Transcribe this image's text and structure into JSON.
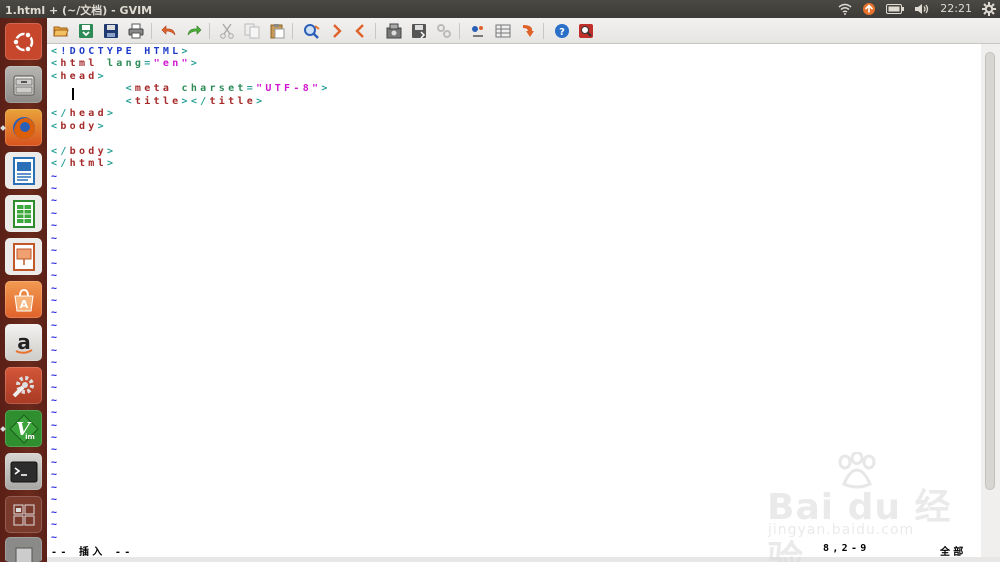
{
  "window": {
    "title": "1.html + (~/文档) - GVIM"
  },
  "panel": {
    "indicators": [
      "wifi-icon",
      "update-icon",
      "battery-icon",
      "volume-icon"
    ],
    "clock": "22:21",
    "settings_icon": "gear-icon"
  },
  "launcher": {
    "items": [
      {
        "name": "ubuntu-dash-button",
        "icon": "ubuntu-logo-icon",
        "color": "#c6472b"
      },
      {
        "name": "files-launcher",
        "icon": "file-cabinet-icon",
        "color": "#9a9a98"
      },
      {
        "name": "firefox-launcher",
        "icon": "firefox-icon",
        "color": "#e66000"
      },
      {
        "name": "writer-launcher",
        "icon": "writer-document-icon",
        "color": "#2a6fb8"
      },
      {
        "name": "calc-launcher",
        "icon": "calc-spreadsheet-icon",
        "color": "#2e8b2e"
      },
      {
        "name": "impress-launcher",
        "icon": "impress-presentation-icon",
        "color": "#c0582a"
      },
      {
        "name": "software-center-launcher",
        "icon": "software-bag-icon",
        "color": "#e8712b"
      },
      {
        "name": "amazon-launcher",
        "icon": "amazon-icon",
        "color": "#d8d6d2"
      },
      {
        "name": "system-settings-launcher",
        "icon": "wrench-gear-icon",
        "color": "#b8402a"
      },
      {
        "name": "vim-launcher",
        "icon": "vim-icon",
        "color": "#2f8f2f"
      },
      {
        "name": "terminal-launcher",
        "icon": "terminal-icon",
        "color": "#2c2c2c"
      },
      {
        "name": "workspace-switcher",
        "icon": "workspace-icon",
        "color": "#7a3a2c"
      },
      {
        "name": "trash-launcher",
        "icon": "trash-icon",
        "color": "#8a8a88"
      }
    ]
  },
  "toolbar": {
    "buttons": [
      "open-icon",
      "save-icon",
      "save-all-icon",
      "print-icon",
      "undo-icon",
      "redo-icon",
      "cut-icon",
      "copy-icon",
      "paste-icon",
      "find-replace-icon",
      "find-next-icon",
      "find-prev-icon",
      "load-session-icon",
      "save-session-icon",
      "run-script-icon",
      "make-icon",
      "shell-icon",
      "ctags-icon",
      "help-icon",
      "find-help-icon"
    ]
  },
  "editor": {
    "lines": [
      [
        [
          "<",
          "brk"
        ],
        [
          "!DOCTYPE HTML",
          "decl"
        ],
        [
          ">",
          "brk"
        ]
      ],
      [
        [
          "<",
          "brk"
        ],
        [
          "html",
          "tag"
        ],
        [
          " lang",
          "attr"
        ],
        [
          "=",
          "brk"
        ],
        [
          "\"en\"",
          "str"
        ],
        [
          ">",
          "brk"
        ]
      ],
      [
        [
          "<",
          "brk"
        ],
        [
          "head",
          "tag"
        ],
        [
          ">",
          "brk"
        ]
      ],
      [
        [
          "        <",
          "brk"
        ],
        [
          "meta",
          "tag"
        ],
        [
          " charset",
          "attr"
        ],
        [
          "=",
          "brk"
        ],
        [
          "\"UTF-8\"",
          "str"
        ],
        [
          ">",
          "brk"
        ]
      ],
      [
        [
          "        <",
          "brk"
        ],
        [
          "title",
          "tag"
        ],
        [
          "></",
          "brk"
        ],
        [
          "title",
          "tag"
        ],
        [
          ">",
          "brk"
        ]
      ],
      [
        [
          "</",
          "brk"
        ],
        [
          "head",
          "tag"
        ],
        [
          ">",
          "brk"
        ]
      ],
      [
        [
          "<",
          "brk"
        ],
        [
          "body",
          "tag"
        ],
        [
          ">",
          "brk"
        ]
      ],
      [],
      [
        [
          "</",
          "brk"
        ],
        [
          "body",
          "tag"
        ],
        [
          ">",
          "brk"
        ]
      ],
      [
        [
          "</",
          "brk"
        ],
        [
          "html",
          "tag"
        ],
        [
          ">",
          "brk"
        ]
      ]
    ],
    "tilde_count": 30,
    "tilde_char": "~"
  },
  "status": {
    "mode": "-- 插入 --",
    "position": "8,2-9",
    "scroll": "全部"
  },
  "watermark": {
    "main": "Bai du 经验",
    "sub": "jingyan.baidu.com"
  }
}
